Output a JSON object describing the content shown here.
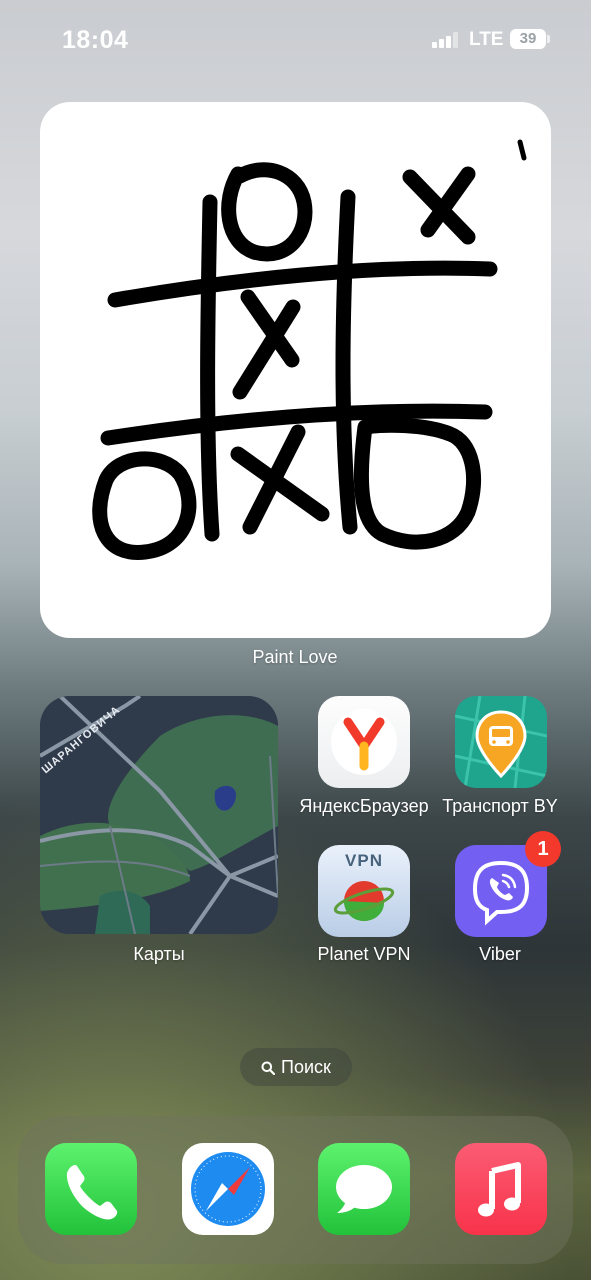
{
  "status_bar": {
    "time": "18:04",
    "network": "LTE",
    "battery": "39"
  },
  "widgets": {
    "paint": {
      "label": "Paint Love"
    },
    "maps": {
      "label": "Карты",
      "street_label": "ШАРАНГОВИЧА"
    }
  },
  "apps": [
    {
      "label": "ЯндексБраузер",
      "icon": "yandex-browser-icon"
    },
    {
      "label": "Транспорт BY",
      "icon": "transport-bus-icon"
    },
    {
      "label": "Planet VPN",
      "icon": "planet-vpn-icon",
      "icon_text": "VPN"
    },
    {
      "label": "Viber",
      "icon": "viber-icon",
      "badge": "1"
    }
  ],
  "search": {
    "label": "Поиск"
  },
  "dock": [
    {
      "name": "phone",
      "icon": "phone-icon"
    },
    {
      "name": "safari",
      "icon": "safari-compass-icon"
    },
    {
      "name": "messages",
      "icon": "messages-bubble-icon"
    },
    {
      "name": "music",
      "icon": "music-note-icon"
    }
  ]
}
